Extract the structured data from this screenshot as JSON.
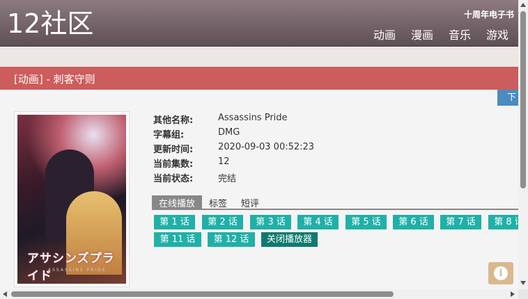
{
  "header": {
    "logo": "12社区",
    "tenyear": "十周年电子书",
    "nav": [
      "动画",
      "漫画",
      "音乐",
      "游戏"
    ]
  },
  "page_title": "[动画] - 刺客守则",
  "download_label": "下",
  "poster": {
    "title": "アサシンズプライド",
    "subtitle": "ASSASSINS PRIDE"
  },
  "info": [
    {
      "key": "其他名称:",
      "value": "Assassins Pride"
    },
    {
      "key": "字幕组:",
      "value": "DMG"
    },
    {
      "key": "更新时间:",
      "value": "2020-09-03 00:52:23"
    },
    {
      "key": "当前集数:",
      "value": "12"
    },
    {
      "key": "当前状态:",
      "value": "完结"
    }
  ],
  "tabs": [
    "在线播放",
    "标签",
    "短评"
  ],
  "episodes": [
    "第 1 话",
    "第 2 话",
    "第 3 话",
    "第 4 话",
    "第 5 话",
    "第 6 话",
    "第 7 话",
    "第 8 话",
    "第 11 话",
    "第 12 话"
  ],
  "close_player": "关闭播放器",
  "info_icon": "i",
  "colors": {
    "header": "#6e5d64",
    "title_bar": "#cd5c5c",
    "episode_button": "#20b0a8",
    "close_button": "#107a70",
    "download_button": "#4a8bc0"
  }
}
